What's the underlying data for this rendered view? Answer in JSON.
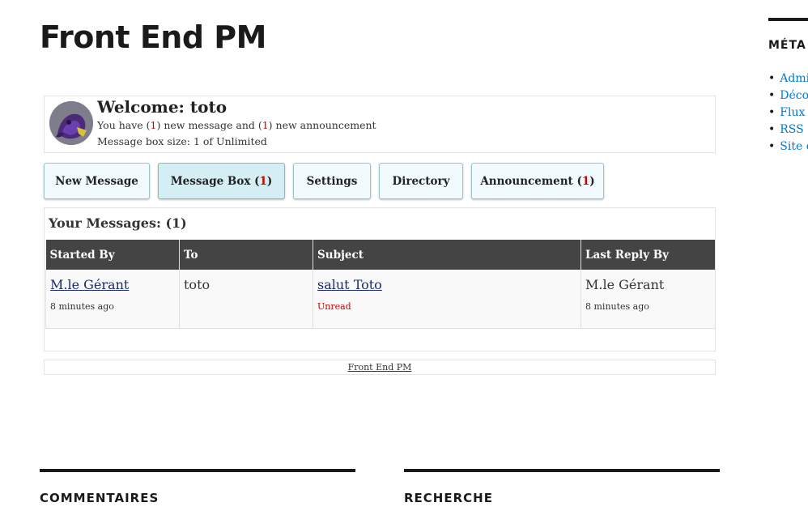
{
  "page": {
    "title": "Front End PM"
  },
  "welcome": {
    "title": "Welcome: toto",
    "line1_before": "You have (",
    "line1_count1": "1",
    "line1_middle": ") new message and (",
    "line1_count2": "1",
    "line1_after": ") new announcement",
    "line2": "Message box size: 1 of Unlimited"
  },
  "tabs": {
    "new_message": "New Message",
    "message_box_label": "Message Box (",
    "message_box_count": "1",
    "message_box_close": ")",
    "settings": "Settings",
    "directory": "Directory",
    "announcement_label": "Announcement (",
    "announcement_count": "1",
    "announcement_close": ")"
  },
  "messages": {
    "heading": "Your Messages: (1)",
    "columns": [
      "Started By",
      "To",
      "Subject",
      "Last Reply By"
    ],
    "rows": [
      {
        "started_by": "M.le Gérant",
        "started_time": "8 minutes ago",
        "to": "toto",
        "subject": "salut Toto",
        "status": "Unread",
        "last_reply_by": "M.le Gérant",
        "last_reply_time": "8 minutes ago"
      }
    ]
  },
  "footer": {
    "link": "Front End PM"
  },
  "sidebar": {
    "heading": "MÉTA",
    "items": [
      "Admi",
      "Décor",
      "Flux",
      "RSS d",
      "Site c"
    ]
  },
  "bottom": {
    "comments_heading": "COMMENTAIRES",
    "search_heading": "RECHERCHE"
  },
  "colors": {
    "accent": "#cc0000",
    "link": "#007acc",
    "header_bg": "#444444",
    "tab_bg": "#f1fafc"
  }
}
